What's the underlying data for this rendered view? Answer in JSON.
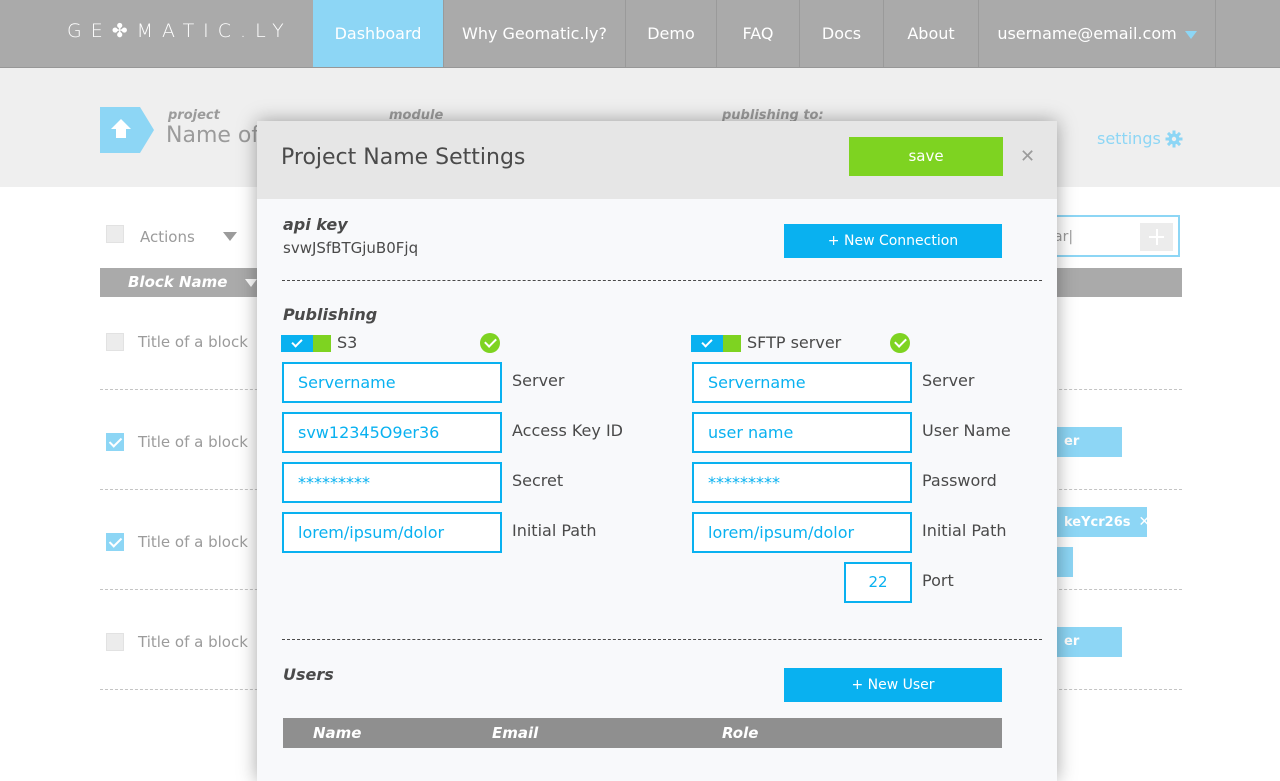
{
  "nav": {
    "logo": "GE✤MATIC.LY",
    "items": [
      "Dashboard",
      "Why Geomatic.ly?",
      "Demo",
      "FAQ",
      "Docs",
      "About"
    ],
    "user": "username@email.com",
    "active_color": "#8dd6f5"
  },
  "header": {
    "project_label": "project",
    "project_name": "Name of",
    "module_label": "module",
    "publishing_label": "publishing to:",
    "settings_label": "settings"
  },
  "table": {
    "actions_label": "Actions",
    "column_block_name": "Block Name",
    "rows": [
      "Title of a block",
      "Title of a block",
      "Title of a block",
      "Title of a block"
    ],
    "row_checked": [
      false,
      true,
      true,
      false
    ],
    "search_value": "ar|",
    "tags": [
      "er tag",
      "keYcr26s",
      "er tag"
    ]
  },
  "modal": {
    "title": "Project Name Settings",
    "save_label": "save",
    "close_icon": "close-icon",
    "api_key_label": "api key",
    "api_key_value": "svwJSfBTGjuB0Fjq",
    "new_connection_label": "+ New Connection",
    "publishing_label": "Publishing",
    "s3": {
      "name": "S3",
      "server_value": "Servername",
      "server_label": "Server",
      "access_key_value": "svw12345O9er36",
      "access_key_label": "Access Key ID",
      "secret_value": "*********",
      "secret_label": "Secret",
      "path_value": "lorem/ipsum/dolor",
      "path_label": "Initial Path"
    },
    "sftp": {
      "name": "SFTP server",
      "server_value": "Servername",
      "server_label": "Server",
      "user_value": "user name",
      "user_label": "User Name",
      "password_value": "*********",
      "password_label": "Password",
      "path_value": "lorem/ipsum/dolor",
      "path_label": "Initial Path",
      "port_value": "22",
      "port_label": "Port"
    },
    "users_label": "Users",
    "new_user_label": "+ New User",
    "users_columns": [
      "Name",
      "Email",
      "Role"
    ]
  },
  "colors": {
    "accent_blue": "#09b1f0",
    "save_green": "#7ed321",
    "nav_gray": "#aaaaaa"
  }
}
